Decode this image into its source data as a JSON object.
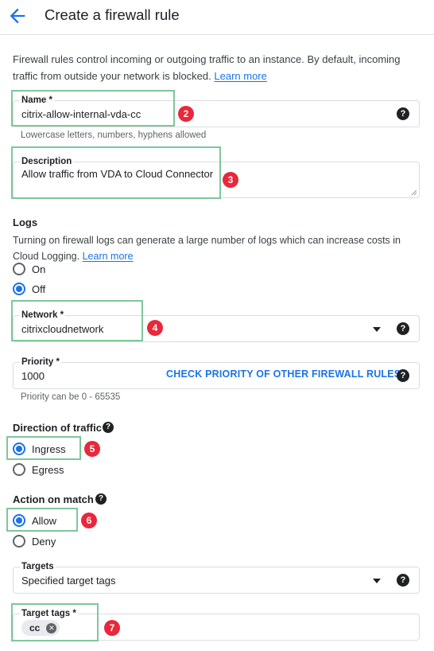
{
  "header": {
    "back_icon": "arrow-back-icon",
    "title": "Create a firewall rule"
  },
  "intro": {
    "text": "Firewall rules control incoming or outgoing traffic to an instance. By default, incoming traffic from outside your network is blocked.",
    "link": "Learn more"
  },
  "name_field": {
    "label": "Name *",
    "value": "citrix-allow-internal-vda-cc",
    "hint": "Lowercase letters, numbers, hyphens allowed",
    "help_icon": "help-icon"
  },
  "description_field": {
    "label": "Description",
    "value": "Allow traffic from VDA to Cloud Connector"
  },
  "logs": {
    "title": "Logs",
    "text": "Turning on firewall logs can generate a large number of logs which can increase costs in Cloud Logging.",
    "link": "Learn more",
    "options": [
      "On",
      "Off"
    ],
    "selected": "Off"
  },
  "network_field": {
    "label": "Network *",
    "value": "citrixcloudnetwork"
  },
  "priority_field": {
    "label": "Priority *",
    "value": "1000",
    "action": "CHECK PRIORITY OF OTHER FIREWALL RULES",
    "hint": "Priority can be 0 - 65535"
  },
  "direction": {
    "title": "Direction of traffic",
    "options": [
      "Ingress",
      "Egress"
    ],
    "selected": "Ingress"
  },
  "action_on_match": {
    "title": "Action on match",
    "options": [
      "Allow",
      "Deny"
    ],
    "selected": "Allow"
  },
  "targets_field": {
    "label": "Targets",
    "value": "Specified target tags"
  },
  "target_tags_field": {
    "label": "Target tags *",
    "chips": [
      "cc"
    ]
  },
  "steps": [
    "2",
    "3",
    "4",
    "5",
    "6",
    "7"
  ],
  "colors": {
    "accent": "#1a73e8",
    "highlight": "#7fc69b",
    "step_badge": "#e8283b"
  }
}
